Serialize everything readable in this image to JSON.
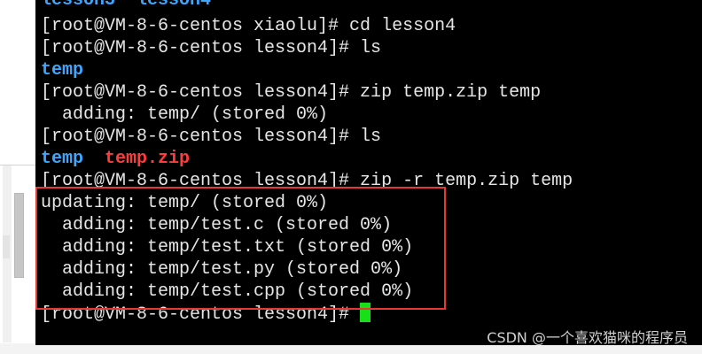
{
  "terminal": {
    "line0": {
      "dir1": "lesson3",
      "sep": "  ",
      "dir2": "lesson4"
    },
    "line1": "[root@VM-8-6-centos xiaolu]# cd lesson4",
    "line2": "[root@VM-8-6-centos lesson4]# ls",
    "line3": {
      "dir": "temp"
    },
    "line4": "[root@VM-8-6-centos lesson4]# zip temp.zip temp",
    "line5": "  adding: temp/ (stored 0%)",
    "line6": "[root@VM-8-6-centos lesson4]# ls",
    "line7": {
      "dir": "temp",
      "sep": "  ",
      "zip": "temp.zip"
    },
    "line8": "[root@VM-8-6-centos lesson4]# zip -r temp.zip temp",
    "line9": "updating: temp/ (stored 0%)",
    "line10": "  adding: temp/test.c (stored 0%)",
    "line11": "  adding: temp/test.txt (stored 0%)",
    "line12": "  adding: temp/test.py (stored 0%)",
    "line13": "  adding: temp/test.cpp (stored 0%)",
    "line14": "[root@VM-8-6-centos lesson4]# "
  },
  "watermark": "CSDN @一个喜欢猫咪的程序员",
  "colors": {
    "terminal_bg": "#000000",
    "text": "#e6e6e6",
    "directory": "#3ba7ff",
    "archive": "#ff3b3b",
    "cursor": "#18e018",
    "highlight_border": "#e53935"
  }
}
